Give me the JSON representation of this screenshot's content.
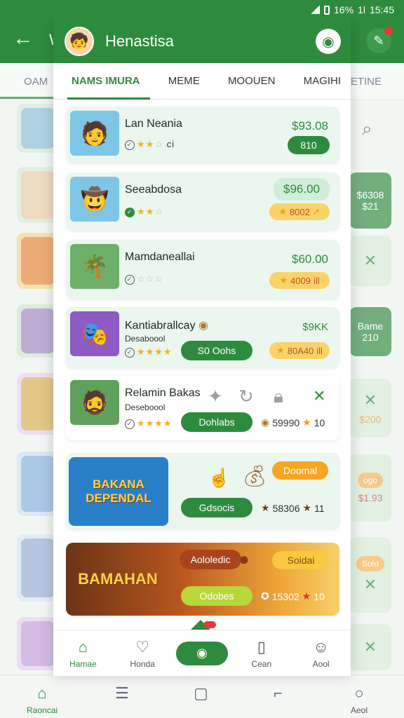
{
  "status": {
    "battery": "16%",
    "signal": "1l",
    "time": "15:45"
  },
  "background": {
    "appbar_letter": "W",
    "tab_left": "OAM",
    "tab_right": "BETINE",
    "right_items": [
      {
        "text": "",
        "kind": "search"
      },
      {
        "text": "$6308\n$21",
        "kind": "dark"
      },
      {
        "text": "",
        "kind": "x"
      },
      {
        "text": "Bame\n210",
        "kind": "dark"
      },
      {
        "text": "",
        "kind": "x"
      },
      {
        "text": "$200",
        "kind": "y"
      },
      {
        "text": "ogo",
        "kind": "pill"
      },
      {
        "text": "$1.93",
        "kind": "light"
      },
      {
        "text": "Solo",
        "kind": "pill"
      },
      {
        "text": "",
        "kind": "x"
      }
    ],
    "nav": [
      {
        "label": "Raoncai",
        "icon": "home-icon"
      },
      {
        "label": "",
        "icon": "menu-icon"
      },
      {
        "label": "",
        "icon": "square-icon"
      },
      {
        "label": "",
        "icon": "back-icon"
      },
      {
        "label": "Aeol",
        "icon": "circle-icon"
      }
    ]
  },
  "modal": {
    "title": "Henastisa",
    "tabs": [
      {
        "label": "NAMS IMURA",
        "active": true
      },
      {
        "label": "MEME",
        "active": false
      },
      {
        "label": "MOOUEN",
        "active": false
      },
      {
        "label": "MAGIHI",
        "active": false
      }
    ],
    "items": [
      {
        "name": "Lan Neania",
        "sub": "",
        "rating": 3,
        "rating_suffix": "ci",
        "price": "$93.08",
        "btn": "810",
        "badge": ""
      },
      {
        "name": "Seeabdosa",
        "sub": "",
        "rating": 3,
        "rating_suffix": "",
        "price": "$96.00",
        "btn": "",
        "badge": "8002"
      },
      {
        "name": "Mamdaneallai",
        "sub": "",
        "rating": 0,
        "rating_suffix": "",
        "price": "$60.00",
        "btn": "",
        "badge": "4009"
      },
      {
        "name": "Kantiabrallcay",
        "sub": "Desaboool",
        "rating": 4,
        "rating_suffix": "",
        "price": "$9KK",
        "btn": "S0 Oohs",
        "badge": "80A40"
      },
      {
        "name": "Relamin Bakas",
        "sub": "Deseboool",
        "rating": 4,
        "rating_suffix": "",
        "price": "",
        "btn": "Dohlabs",
        "badge": "",
        "coins": "59990",
        "stars": "10"
      }
    ],
    "banners": [
      {
        "title": "BAKANA DEPENDAL",
        "btn": "Gdsocis",
        "badge": "Doomal",
        "coins": "58306",
        "stars": "11"
      },
      {
        "title": "BAMAHAN",
        "pill": "Aololedic",
        "btn": "Odobes",
        "badge": "Soidai",
        "coins": "15302",
        "stars": "10"
      }
    ],
    "nav": [
      {
        "label": "Hamae",
        "icon": "home-icon",
        "active": true
      },
      {
        "label": "Honda",
        "icon": "badge-icon",
        "active": false
      },
      {
        "label": "",
        "icon": "coin-icon",
        "active": false
      },
      {
        "label": "Cean",
        "icon": "clipboard-icon",
        "active": false
      },
      {
        "label": "Aool",
        "icon": "person-icon",
        "active": false
      }
    ]
  }
}
